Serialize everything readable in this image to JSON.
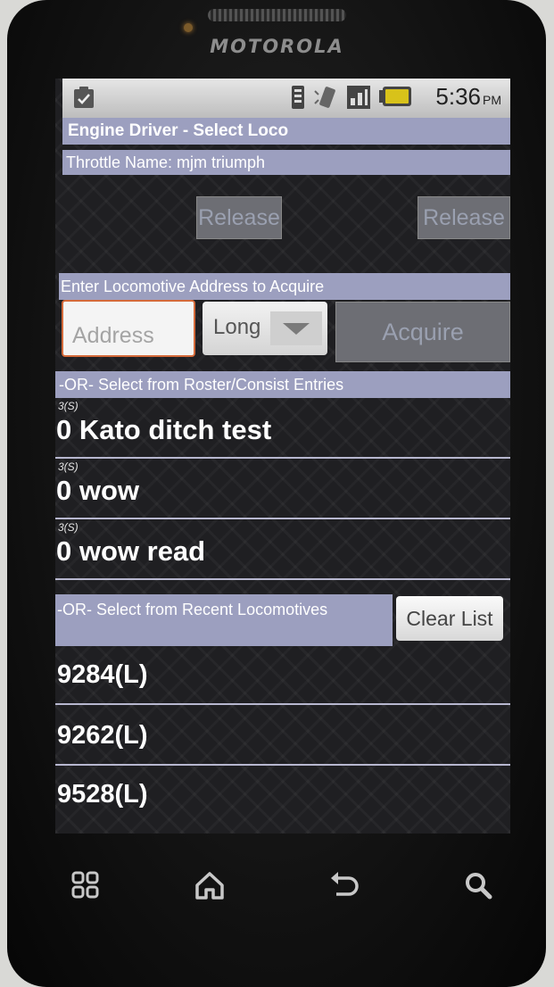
{
  "device": {
    "brand": "MOTOROLA"
  },
  "status_bar": {
    "time": "5:36",
    "ampm": "PM",
    "icons": [
      "clipboard-icon",
      "signal-icon",
      "vibrate-icon",
      "network-icon",
      "battery-icon"
    ]
  },
  "app": {
    "title": "Engine Driver - Select Loco",
    "throttle_name": "Throttle Name: mjm triumph",
    "release_buttons": [
      "Release",
      "Release"
    ],
    "enter_address_label": "Enter Locomotive Address to Acquire",
    "address_placeholder": "Address",
    "address_type": "Long",
    "acquire_label": "Acquire",
    "roster_header": "-OR- Select from Roster/Consist Entries",
    "roster_items": [
      {
        "sub": "3(S)",
        "name": "0 Kato ditch test"
      },
      {
        "sub": "3(S)",
        "name": "0 wow"
      },
      {
        "sub": "3(S)",
        "name": "0 wow read"
      }
    ],
    "recent_header": "-OR- Select from Recent Locomotives",
    "clear_list_label": "Clear List",
    "recent_items": [
      "9284(L)",
      "9262(L)",
      "9528(L)"
    ]
  },
  "softkeys": [
    "menu-icon",
    "home-icon",
    "back-icon",
    "search-icon"
  ],
  "colors": {
    "header_bar": "#9c9fbf",
    "address_border": "#d46a3a",
    "screen_bg": "#1f1f22"
  }
}
